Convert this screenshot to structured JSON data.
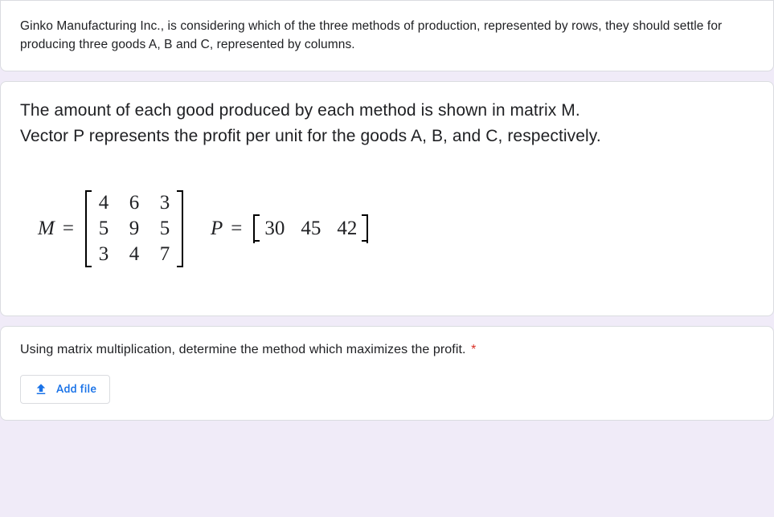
{
  "intro": "Ginko Manufacturing Inc., is considering which of the three methods of production, represented by rows, they should settle for producing three goods A, B and C, represented by columns.",
  "description1": "The amount of each good produced by each method is shown in matrix M.",
  "description2": "Vector P represents the profit per unit for the goods A, B, and C, respectively.",
  "m_label": "M",
  "p_label": "P",
  "eq": "=",
  "chart_data": {
    "type": "table",
    "M": [
      [
        4,
        6,
        3
      ],
      [
        5,
        9,
        5
      ],
      [
        3,
        4,
        7
      ]
    ],
    "P": [
      30,
      45,
      42
    ]
  },
  "question": "Using matrix multiplication, determine the method which maximizes the profit.",
  "required_mark": "*",
  "add_file_label": "Add file"
}
